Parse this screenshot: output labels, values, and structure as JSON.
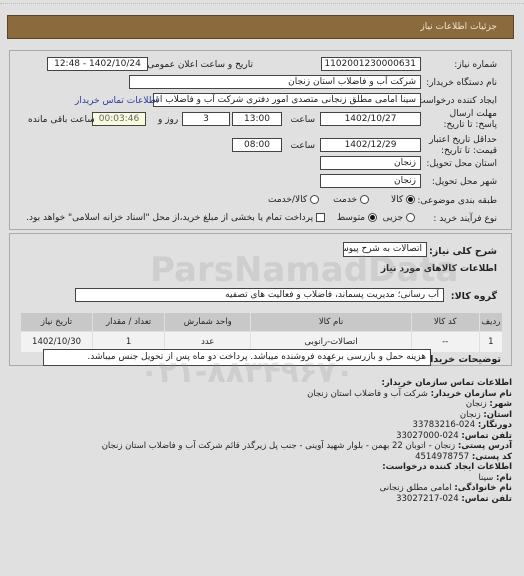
{
  "header": {
    "title": "جزئیات اطلاعات نیاز"
  },
  "form": {
    "need_number_label": "شماره نیاز:",
    "need_number": "1102001230000631",
    "announce_label": "تاریخ و ساعت اعلان عمومی:",
    "announce_value": "1402/10/24 - 12:48",
    "buyer_org_label": "نام دستگاه خریدار:",
    "buyer_org": "شرکت آب و فاضلاب استان زنجان",
    "creator_label": "ایجاد کننده درخواست:",
    "creator": "سینا امامی مطلق زنجانی متصدی امور دفتری شرکت آب و فاضلاب استان زنجان",
    "buyer_contact_link": "اطلاعات تماس خریدار",
    "deadline_label": "مهلت ارسال پاسخ: تا تاریخ:",
    "deadline_date": "1402/10/27",
    "time_label": "ساعت",
    "deadline_time": "13:00",
    "days_value": "3",
    "days_label": "روز و",
    "remaining_time": "00:03:46",
    "remaining_label": "ساعت باقی مانده",
    "validity_label": "حداقل تاریخ اعتبار قیمت: تا تاریخ:",
    "validity_date": "1402/12/29",
    "validity_time": "08:00",
    "province_label": "استان محل تحویل:",
    "province": "زنجان",
    "city_label": "شهر محل تحویل:",
    "city": "زنجان",
    "category_label": "طبقه بندی موضوعی:",
    "category_options": [
      {
        "label": "کالا",
        "selected": true
      },
      {
        "label": "خدمت",
        "selected": false
      },
      {
        "label": "کالا/خدمت",
        "selected": false
      }
    ],
    "process_label": "نوع فرآیند خرید :",
    "process_options": [
      {
        "label": "جزیی",
        "selected": false
      },
      {
        "label": "متوسط",
        "selected": true
      }
    ],
    "payment_checkbox_label": "پرداخت تمام یا بخشی از مبلغ خرید،از محل \"اسناد خزانه اسلامی\" خواهد بود.",
    "payment_checked": false
  },
  "details": {
    "summary_label": "شرح کلی نیاز:",
    "summary": "اتصالات به شرح پیوست",
    "goods_info_title": "اطلاعات کالاهای مورد نیاز",
    "group_label": "گروه کالا:",
    "group": "آب رسانی؛ مدیریت پسماند، فاضلاب و فعالیت های تصفیه",
    "table": {
      "columns": [
        "ردیف",
        "کد کالا",
        "نام کالا",
        "واحد شمارش",
        "تعداد / مقدار",
        "تاریخ نیاز"
      ],
      "rows": [
        [
          "1",
          "--",
          "اتصالات-رانوبی",
          "عدد",
          "1",
          "1402/10/30"
        ]
      ]
    },
    "buyer_notes_label": "توضیحات خریدار:",
    "buyer_notes": "هزینه حمل و بازرسی برعهده فروشنده میباشد. پرداخت دو ماه پس از تحویل جنس میباشد."
  },
  "contact": {
    "title": "اطلاعات تماس سازمان خریدار:",
    "org_label": "نام سازمان خریدار:",
    "org": "شرکت آب و فاضلاب استان زنجان",
    "city_label": "شهر:",
    "city": "زنجان",
    "province_label": "استان:",
    "province": "زنجان",
    "fax_label": "دورنگار:",
    "fax": "024-33783216",
    "phone_label": "تلفن تماس:",
    "phone": "024-33027000",
    "address_label": "آدرس پستی:",
    "address": "زنجان - اتوبان 22 بهمن - بلوار شهید آوینی - جنب پل زیرگذر قائم شرکت آب و فاضلاب استان زنجان",
    "postal_label": "کد پستی:",
    "postal": "4514978757",
    "creator_title": "اطلاعات ایجاد کننده درخواست:",
    "name_label": "نام:",
    "name": "سینا",
    "family_label": "نام خانوادگی:",
    "family": "امامی مطلق زنجانی",
    "creator_phone_label": "تلفن تماس:",
    "creator_phone": "024-33027217"
  },
  "watermark": {
    "brand": "ParsNamadData",
    "phone": "۰۲۱-۸۸۳۴۹۶۷۰"
  }
}
